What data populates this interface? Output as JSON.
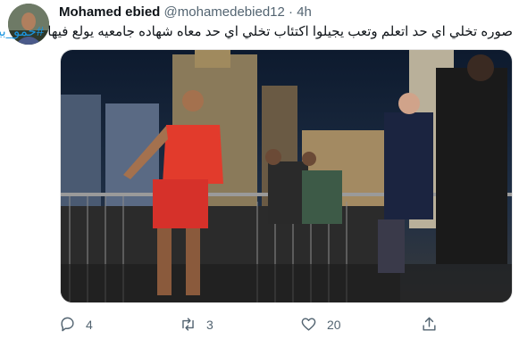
{
  "tweet": {
    "author_name": "Mohamed ebied",
    "author_handle": "@mohamedebied12",
    "separator": "·",
    "timestamp": "4h",
    "text": "صوره تخلي اي حد اتعلم وتعب يجيلوا اكتئاب تخلي اي حد معاه شهاده جامعيه يولع فيها",
    "hashtag": "#حمو_بيكا",
    "avatar_icon": "user-avatar",
    "media_icon": "tweet-photo"
  },
  "actions": {
    "reply_count": "4",
    "retweet_count": "3",
    "like_count": "20"
  },
  "colors": {
    "hashtag": "#1b95e0",
    "muted": "#536471"
  }
}
